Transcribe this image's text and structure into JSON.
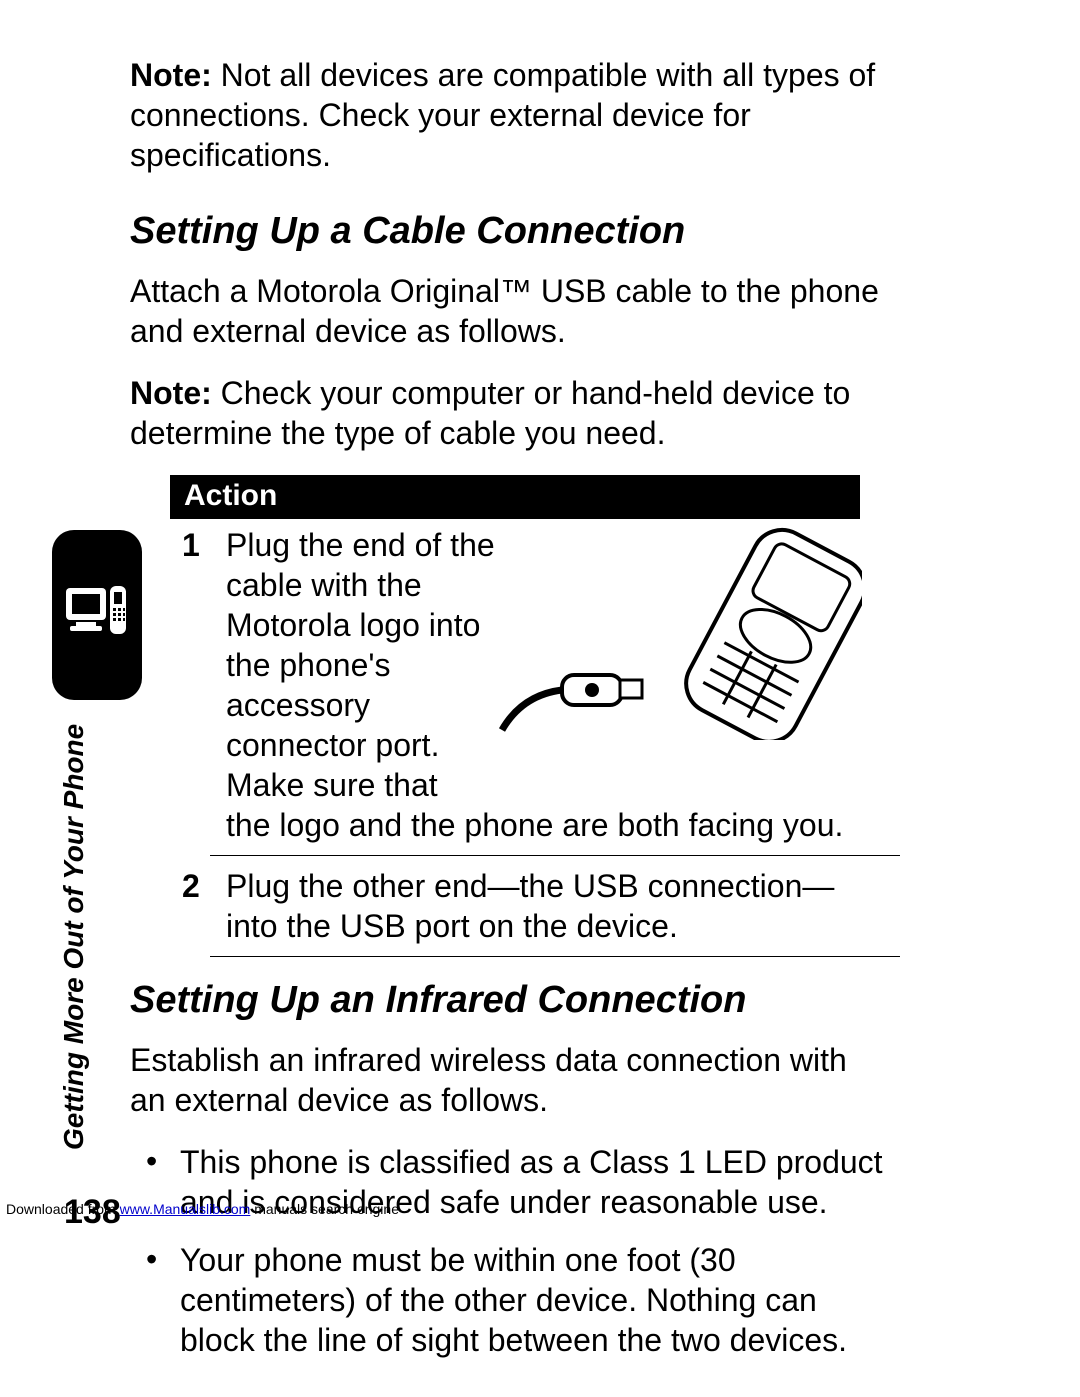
{
  "note_intro": {
    "label": "Note:",
    "text": " Not all devices are compatible with all types of connections. Check your external device for specifications."
  },
  "section_cable": {
    "heading": "Setting Up a Cable Connection",
    "para1": "Attach a Motorola Original™ USB cable to the phone and external device as follows.",
    "note_label": "Note:",
    "note_text": " Check your computer or hand-held device to determine the type of cable you need.",
    "action_header": "Action",
    "steps": [
      {
        "num": "1",
        "text_narrow": "Plug the end of the cable with the Motorola logo into the phone's accessory connector port. Make sure that",
        "text_wrap": " the logo and the phone are both facing you."
      },
      {
        "num": "2",
        "text": "Plug the other end—the USB connection—into the USB port on the device."
      }
    ]
  },
  "section_ir": {
    "heading": "Setting Up an Infrared Connection",
    "para1": "Establish an infrared wireless data connection with an external device as follows.",
    "bullets": [
      "This phone is classified as a Class 1 LED product and is considered safe under reasonable use.",
      "Your phone must be within one foot (30 centimeters) of the other device. Nothing can block the line of sight between the two devices."
    ]
  },
  "side": {
    "label": "Getting More Out of Your Phone"
  },
  "page_number": "138",
  "footer": {
    "prefix": "Downloaded from ",
    "link": "www.Manualslib.com",
    "suffix": " manuals search engine"
  }
}
